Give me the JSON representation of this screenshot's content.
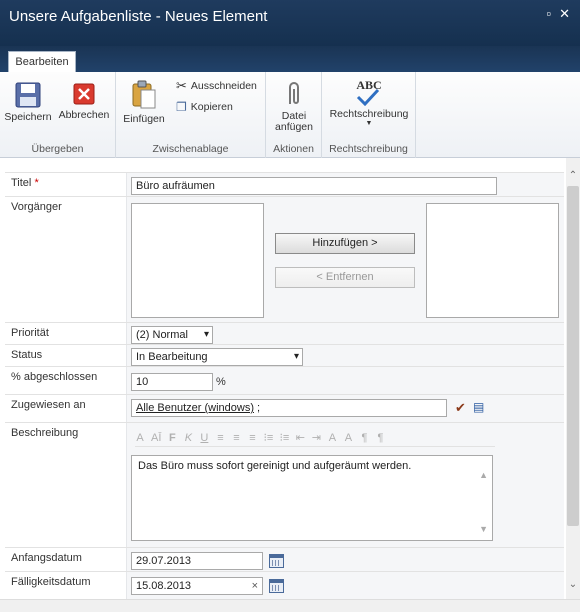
{
  "window": {
    "title": "Unsere Aufgabenliste - Neues Element",
    "restore_icon": "restore-window-icon",
    "close_icon": "close-icon"
  },
  "tabs": [
    {
      "label": "Bearbeiten"
    }
  ],
  "ribbon": {
    "groups": {
      "uebergeben": {
        "label": "Übergeben",
        "save": "Speichern",
        "cancel": "Abbrechen"
      },
      "zwischenablage": {
        "label": "Zwischenablage",
        "paste": "Einfügen",
        "cut": "Ausschneiden",
        "copy": "Kopieren"
      },
      "aktionen": {
        "label": "Aktionen",
        "attach_line1": "Datei",
        "attach_line2": "anfügen"
      },
      "rechtschreibung": {
        "label": "Rechtschreibung",
        "spell": "Rechtschreibung",
        "abc": "ABC"
      }
    }
  },
  "form": {
    "title": {
      "label": "Titel",
      "required_mark": "*",
      "value": "Büro aufräumen"
    },
    "vorgaenger": {
      "label": "Vorgänger",
      "add_button": "Hinzufügen >",
      "remove_button": "< Entfernen"
    },
    "prioritaet": {
      "label": "Priorität",
      "value": "(2) Normal"
    },
    "status": {
      "label": "Status",
      "value": "In Bearbeitung"
    },
    "percent": {
      "label": "% abgeschlossen",
      "value": "10",
      "unit": "%"
    },
    "assigned": {
      "label": "Zugewiesen an",
      "value": "Alle Benutzer (windows)",
      "suffix": " ;"
    },
    "description": {
      "label": "Beschreibung",
      "text": "Das Büro muss sofort gereinigt und aufgeräumt werden.",
      "toolbar": [
        "A",
        "AĪ",
        "F",
        "K",
        "U",
        "≡",
        "≡",
        "≡",
        "⁝≡",
        "⁝≡",
        "⇤",
        "⇥",
        "A",
        "A",
        "¶",
        "¶"
      ]
    },
    "start_date": {
      "label": "Anfangsdatum",
      "value": "29.07.2013"
    },
    "due_date": {
      "label": "Fälligkeitsdatum",
      "value": "15.08.2013",
      "clear": "×"
    }
  },
  "colors": {
    "titlebar": "#1f3b5e",
    "required": "#cc0000"
  }
}
